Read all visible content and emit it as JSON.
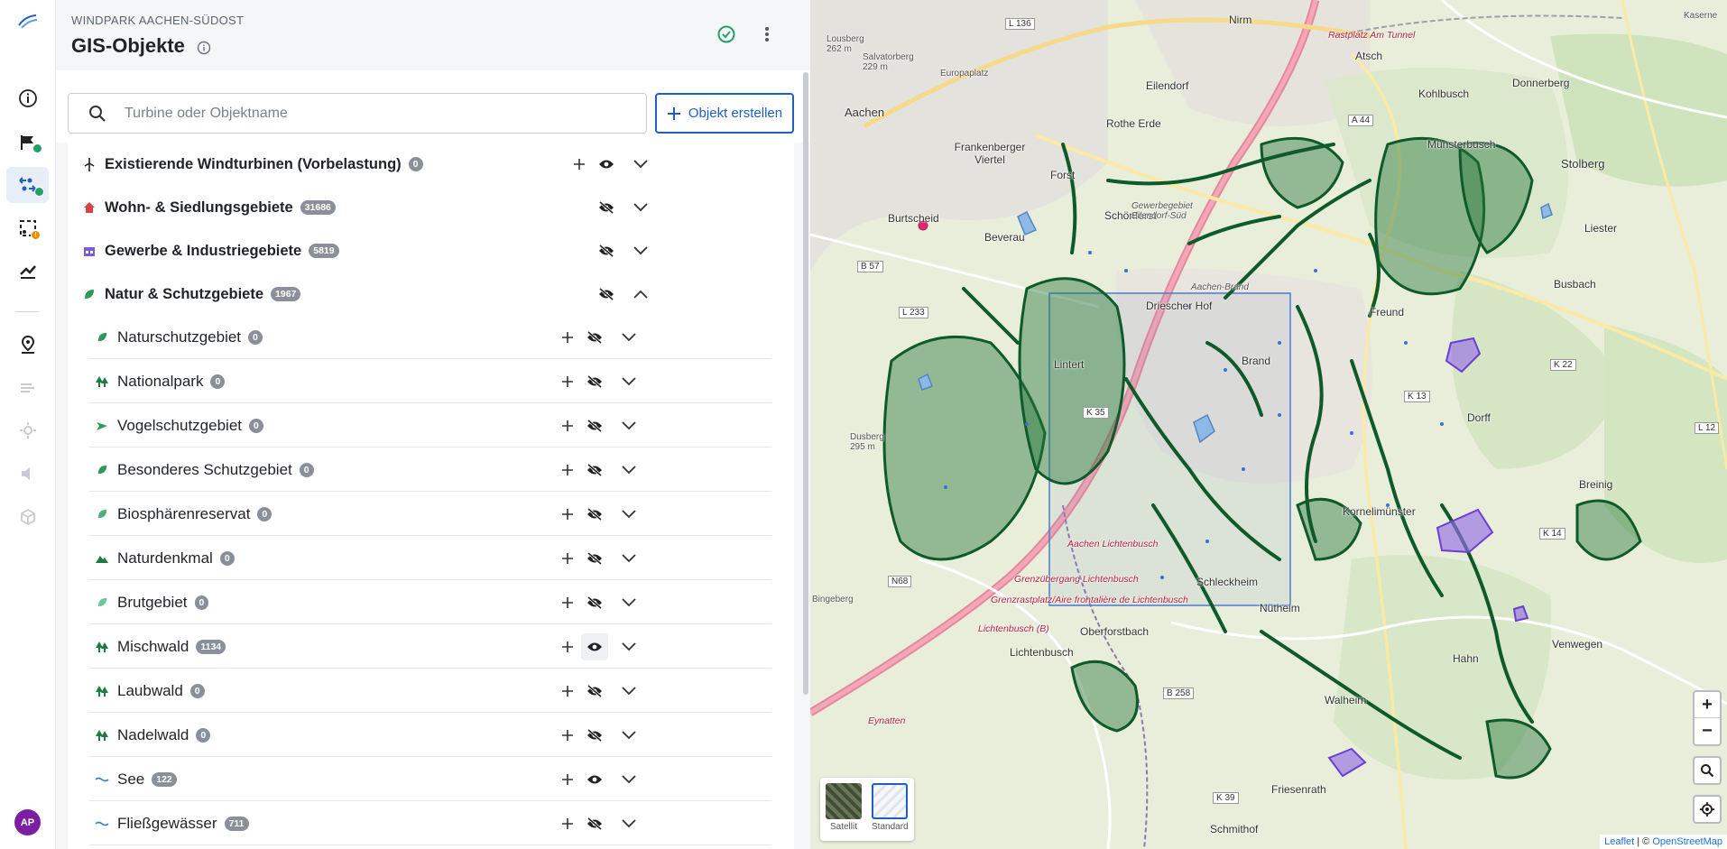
{
  "rail": {
    "avatar": "AP"
  },
  "header": {
    "project": "WINDPARK AACHEN-SÜDOST",
    "title": "GIS-Objekte"
  },
  "toolbar": {
    "search_placeholder": "Turbine oder Objektname",
    "create_label": "Objekt erstellen"
  },
  "categories": [
    {
      "label": "Existierende Windturbinen (Vorbelastung)",
      "count": "0"
    },
    {
      "label": "Wohn- & Siedlungsgebiete",
      "count": "31686"
    },
    {
      "label": "Gewerbe & Industriegebiete",
      "count": "5819"
    },
    {
      "label": "Natur & Schutzgebiete",
      "count": "1967"
    }
  ],
  "subcategories": [
    {
      "label": "Naturschutzgebiet",
      "count": "0"
    },
    {
      "label": "Nationalpark",
      "count": "0"
    },
    {
      "label": "Vogelschutzgebiet",
      "count": "0"
    },
    {
      "label": "Besonderes Schutzgebiet",
      "count": "0"
    },
    {
      "label": "Biosphärenreservat",
      "count": "0"
    },
    {
      "label": "Naturdenkmal",
      "count": "0"
    },
    {
      "label": "Brutgebiet",
      "count": "0"
    },
    {
      "label": "Mischwald",
      "count": "1134"
    },
    {
      "label": "Laubwald",
      "count": "0"
    },
    {
      "label": "Nadelwald",
      "count": "0"
    },
    {
      "label": "See",
      "count": "122"
    },
    {
      "label": "Fließgewässer",
      "count": "711"
    }
  ],
  "map": {
    "places": [
      "Aachen",
      "Nirm",
      "Eilendorf",
      "Atsch",
      "Donnerberg",
      "Kohlbusch",
      "Münsterbusch",
      "Stolberg",
      "Rothe Erde",
      "Frankenberger Viertel",
      "Forst",
      "Schönforst",
      "Burtscheid",
      "Beverau",
      "Driescher Hof",
      "Freund",
      "Brand",
      "Lintert",
      "Dorff",
      "Busbach",
      "Liester",
      "Breinig",
      "Kornelimünster",
      "Schleckheim",
      "Nütheim",
      "Oberforstbach",
      "Lichtenbusch",
      "Venwegen",
      "Hahn",
      "Walheim",
      "Friesenrath",
      "Schmithof",
      "Bingeberg"
    ],
    "small_labels": [
      "Lousberg 262 m",
      "Salvatorberg 229 m",
      "Europaplatz",
      "Gewerbegebiet Eilendorf-Süd",
      "Aachen-Brand",
      "Dusberg 295 m",
      "Kaserne"
    ],
    "red_labels": [
      "Rastplatz Am Tunnel",
      "Aachen Lichtenbusch",
      "Grenzübergang Lichtenbusch",
      "Grenzrastplatz/Aire frontalière de Lichtenbusch",
      "Lichtenbusch (B)",
      "Eynatten"
    ],
    "shields": [
      "L 136",
      "L 233",
      "B 57",
      "K 35",
      "K 13",
      "K 22",
      "L 12",
      "K 14",
      "N68",
      "B 258",
      "K 39",
      "A 44"
    ],
    "layers": [
      {
        "label": "Satellit"
      },
      {
        "label": "Standard"
      }
    ],
    "attribution_leaflet": "Leaflet",
    "attribution_sep": " | © ",
    "attribution_osm": "OpenStreetMap",
    "zoom_in": "+",
    "zoom_out": "−"
  }
}
